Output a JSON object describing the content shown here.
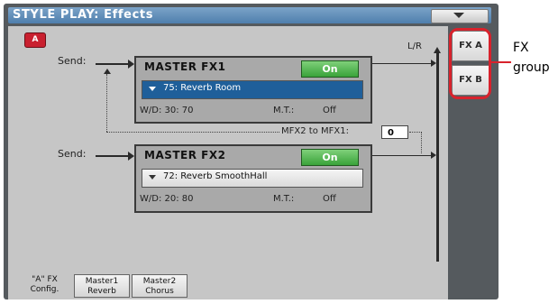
{
  "title": "STYLE PLAY: Effects",
  "badge": "A",
  "lr_label": "L/R",
  "send_label": "Send:",
  "fx1": {
    "name": "MASTER FX1",
    "on_label": "On",
    "preset": "75: Reverb Room",
    "wd": "W/D:  30: 70",
    "mt_label": "M.T.:",
    "mt_value": "Off"
  },
  "fx2": {
    "name": "MASTER FX2",
    "on_label": "On",
    "preset": "72: Reverb SmoothHall",
    "wd": "W/D:  20: 80",
    "mt_label": "M.T.:",
    "mt_value": "Off"
  },
  "mfx_link": {
    "label": "MFX2 to MFX1:",
    "value": "0"
  },
  "side_tabs": [
    "FX A",
    "FX B"
  ],
  "bottom_tabs": [
    {
      "line1": "\"A\" FX",
      "line2": "Config."
    },
    {
      "line1": "Master1",
      "line2": "Reverb"
    },
    {
      "line1": "Master2",
      "line2": "Chorus"
    }
  ],
  "annotation": {
    "line1": "FX",
    "line2": "group"
  },
  "colors": {
    "title_bar": "#5f8fbf",
    "on_green": "#3aa33a",
    "selected_blue": "#1f5f9a",
    "annotation_red": "#d8222c"
  }
}
